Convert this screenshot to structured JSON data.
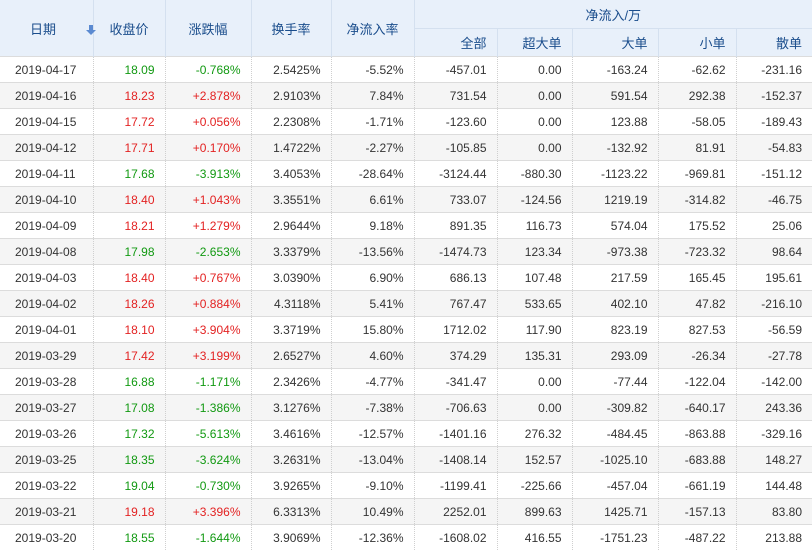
{
  "header": {
    "date": "日期",
    "close": "收盘价",
    "change": "涨跌幅",
    "turnover": "换手率",
    "net_ratio": "净流入率",
    "net_group": "净流入/万",
    "all": "全部",
    "xl": "超大单",
    "l": "大单",
    "m": "小单",
    "s": "散单"
  },
  "colors": {
    "up": "#e32222",
    "down": "#119911",
    "header_bg": "#e8f0fa",
    "header_text": "#1a4d8c"
  },
  "rows": [
    {
      "date": "2019-04-17",
      "close": "18.09",
      "change": "-0.768%",
      "turnover": "2.5425%",
      "ratio": "-5.52%",
      "all": "-457.01",
      "xl": "0.00",
      "l": "-163.24",
      "m": "-62.62",
      "s": "-231.16",
      "dir": "down"
    },
    {
      "date": "2019-04-16",
      "close": "18.23",
      "change": "+2.878%",
      "turnover": "2.9103%",
      "ratio": "7.84%",
      "all": "731.54",
      "xl": "0.00",
      "l": "591.54",
      "m": "292.38",
      "s": "-152.37",
      "dir": "up"
    },
    {
      "date": "2019-04-15",
      "close": "17.72",
      "change": "+0.056%",
      "turnover": "2.2308%",
      "ratio": "-1.71%",
      "all": "-123.60",
      "xl": "0.00",
      "l": "123.88",
      "m": "-58.05",
      "s": "-189.43",
      "dir": "up"
    },
    {
      "date": "2019-04-12",
      "close": "17.71",
      "change": "+0.170%",
      "turnover": "1.4722%",
      "ratio": "-2.27%",
      "all": "-105.85",
      "xl": "0.00",
      "l": "-132.92",
      "m": "81.91",
      "s": "-54.83",
      "dir": "up"
    },
    {
      "date": "2019-04-11",
      "close": "17.68",
      "change": "-3.913%",
      "turnover": "3.4053%",
      "ratio": "-28.64%",
      "all": "-3124.44",
      "xl": "-880.30",
      "l": "-1123.22",
      "m": "-969.81",
      "s": "-151.12",
      "dir": "down"
    },
    {
      "date": "2019-04-10",
      "close": "18.40",
      "change": "+1.043%",
      "turnover": "3.3551%",
      "ratio": "6.61%",
      "all": "733.07",
      "xl": "-124.56",
      "l": "1219.19",
      "m": "-314.82",
      "s": "-46.75",
      "dir": "up"
    },
    {
      "date": "2019-04-09",
      "close": "18.21",
      "change": "+1.279%",
      "turnover": "2.9644%",
      "ratio": "9.18%",
      "all": "891.35",
      "xl": "116.73",
      "l": "574.04",
      "m": "175.52",
      "s": "25.06",
      "dir": "up"
    },
    {
      "date": "2019-04-08",
      "close": "17.98",
      "change": "-2.653%",
      "turnover": "3.3379%",
      "ratio": "-13.56%",
      "all": "-1474.73",
      "xl": "123.34",
      "l": "-973.38",
      "m": "-723.32",
      "s": "98.64",
      "dir": "down"
    },
    {
      "date": "2019-04-03",
      "close": "18.40",
      "change": "+0.767%",
      "turnover": "3.0390%",
      "ratio": "6.90%",
      "all": "686.13",
      "xl": "107.48",
      "l": "217.59",
      "m": "165.45",
      "s": "195.61",
      "dir": "up"
    },
    {
      "date": "2019-04-02",
      "close": "18.26",
      "change": "+0.884%",
      "turnover": "4.3118%",
      "ratio": "5.41%",
      "all": "767.47",
      "xl": "533.65",
      "l": "402.10",
      "m": "47.82",
      "s": "-216.10",
      "dir": "up"
    },
    {
      "date": "2019-04-01",
      "close": "18.10",
      "change": "+3.904%",
      "turnover": "3.3719%",
      "ratio": "15.80%",
      "all": "1712.02",
      "xl": "117.90",
      "l": "823.19",
      "m": "827.53",
      "s": "-56.59",
      "dir": "up"
    },
    {
      "date": "2019-03-29",
      "close": "17.42",
      "change": "+3.199%",
      "turnover": "2.6527%",
      "ratio": "4.60%",
      "all": "374.29",
      "xl": "135.31",
      "l": "293.09",
      "m": "-26.34",
      "s": "-27.78",
      "dir": "up"
    },
    {
      "date": "2019-03-28",
      "close": "16.88",
      "change": "-1.171%",
      "turnover": "2.3426%",
      "ratio": "-4.77%",
      "all": "-341.47",
      "xl": "0.00",
      "l": "-77.44",
      "m": "-122.04",
      "s": "-142.00",
      "dir": "down"
    },
    {
      "date": "2019-03-27",
      "close": "17.08",
      "change": "-1.386%",
      "turnover": "3.1276%",
      "ratio": "-7.38%",
      "all": "-706.63",
      "xl": "0.00",
      "l": "-309.82",
      "m": "-640.17",
      "s": "243.36",
      "dir": "down"
    },
    {
      "date": "2019-03-26",
      "close": "17.32",
      "change": "-5.613%",
      "turnover": "3.4616%",
      "ratio": "-12.57%",
      "all": "-1401.16",
      "xl": "276.32",
      "l": "-484.45",
      "m": "-863.88",
      "s": "-329.16",
      "dir": "down"
    },
    {
      "date": "2019-03-25",
      "close": "18.35",
      "change": "-3.624%",
      "turnover": "3.2631%",
      "ratio": "-13.04%",
      "all": "-1408.14",
      "xl": "152.57",
      "l": "-1025.10",
      "m": "-683.88",
      "s": "148.27",
      "dir": "down"
    },
    {
      "date": "2019-03-22",
      "close": "19.04",
      "change": "-0.730%",
      "turnover": "3.9265%",
      "ratio": "-9.10%",
      "all": "-1199.41",
      "xl": "-225.66",
      "l": "-457.04",
      "m": "-661.19",
      "s": "144.48",
      "dir": "down"
    },
    {
      "date": "2019-03-21",
      "close": "19.18",
      "change": "+3.396%",
      "turnover": "6.3313%",
      "ratio": "10.49%",
      "all": "2252.01",
      "xl": "899.63",
      "l": "1425.71",
      "m": "-157.13",
      "s": "83.80",
      "dir": "up"
    },
    {
      "date": "2019-03-20",
      "close": "18.55",
      "change": "-1.644%",
      "turnover": "3.9069%",
      "ratio": "-12.36%",
      "all": "-1608.02",
      "xl": "416.55",
      "l": "-1751.23",
      "m": "-487.22",
      "s": "213.88",
      "dir": "down"
    }
  ]
}
